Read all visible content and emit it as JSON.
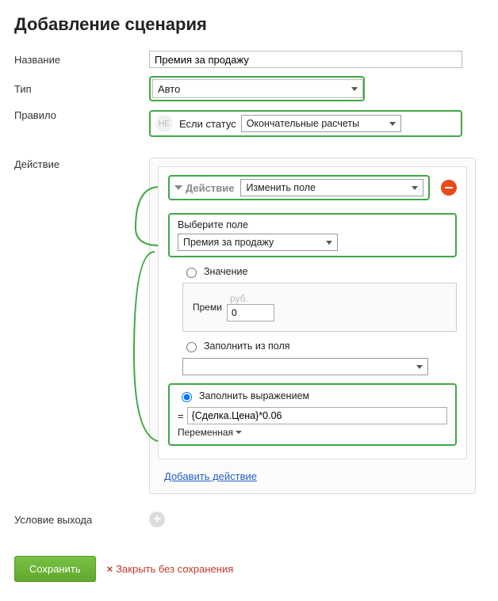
{
  "title": "Добавление сценария",
  "labels": {
    "name": "Название",
    "type": "Тип",
    "rule": "Правило",
    "action": "Действие",
    "exit": "Условие выхода"
  },
  "name_value": "Премия за продажу",
  "type_value": "Авто",
  "rule": {
    "ne": "НЕ",
    "if_status": "Если статус",
    "status_value": "Окончательные расчеты"
  },
  "action_card": {
    "title": "Действие",
    "action_type": "Изменить поле",
    "field_label": "Выберите поле",
    "field_value": "Премия за продажу",
    "radio_value": "Значение",
    "value_prefix": "Преми",
    "value_currency": "руб.",
    "value_amount": "0",
    "radio_fromfield": "Заполнить из поля",
    "fromfield_value": "",
    "radio_expression": "Заполнить выражением",
    "expression_eq": "=",
    "expression_value": "{Сделка.Цена}*0.06",
    "variable_dropdown": "Переменная"
  },
  "add_action_link": "Добавить действие",
  "buttons": {
    "save": "Сохранить",
    "cancel": "Закрыть без сохранения"
  }
}
